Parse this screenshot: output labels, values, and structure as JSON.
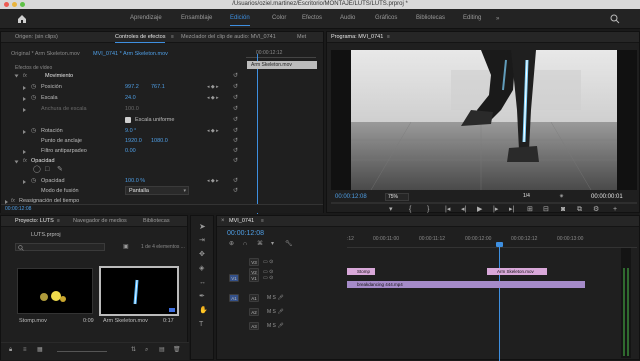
{
  "window": {
    "title": "/Usuarios/oziel.martinez/Escritorio/MONTAJE/LUTS/LUTS.prproj *"
  },
  "workspaces": [
    "Aprendizaje",
    "Ensamblaje",
    "Edición",
    "Color",
    "Efectos",
    "Audio",
    "Gráficos",
    "Bibliotecas",
    "Editing"
  ],
  "active_workspace": "Edición",
  "effect_controls": {
    "tabs": [
      "Origen: (sin clips)",
      "Controles de efectos",
      "Mezclador del clip de audio: MVI_0741",
      "Met"
    ],
    "source_label": "Original * Arm Skeleton.mov",
    "seq_label": "MVI_0741 * Arm Skeleton.mov",
    "ruler_time": "00:00:12:12",
    "clip_name": "Arm Skeleton.mov",
    "video_effects_header": "Efectos de vídeo",
    "motion": "Movimiento",
    "rows": [
      {
        "name": "Posición",
        "v1": "997.2",
        "v2": "767.1"
      },
      {
        "name": "Escala",
        "v1": "24.0",
        "v2": ""
      },
      {
        "name": "Anchura de escala",
        "v1": "100.0",
        "v2": ""
      },
      {
        "name": "",
        "v1": "Escala uniforme",
        "v2": ""
      },
      {
        "name": "Rotación",
        "v1": "9.0 °",
        "v2": ""
      },
      {
        "name": "Punto de anclaje",
        "v1": "1920.0",
        "v2": "1080.0"
      },
      {
        "name": "Filtro antiparpadeo",
        "v1": "0.00",
        "v2": ""
      }
    ],
    "opacity": "Opacidad",
    "opacity_value": "100.0 %",
    "opacity_label": "Opacidad",
    "blend_label": "Modo de fusión",
    "blend_value": "Pantalla",
    "time_remap": "Reasignación del tiempo",
    "timecode": "00:00:12:08"
  },
  "program_monitor": {
    "title": "Programa: MVI_0741",
    "timecode": "00:00:12:08",
    "zoom": "75%",
    "resolution": "1/4",
    "duration": "00:00:00:01"
  },
  "project": {
    "tabs": [
      "Proyecto: LUTS",
      "Navegador de medios",
      "Bibliotecas"
    ],
    "file": "LUTS.prproj",
    "items_count": "1 de 4 elementos ...",
    "clips": [
      {
        "name": "Stomp.mov",
        "dur": "0:09"
      },
      {
        "name": "Arm Skeleton.mov",
        "dur": "0:17"
      }
    ]
  },
  "timeline": {
    "tab": "MVI_0741",
    "timecode": "00:00:12:08",
    "ruler": [
      ":12",
      "00:00:11:00",
      "00:00:11:12",
      "00:00:12:00",
      "00:00:12:12",
      "00:00:13:00"
    ],
    "video_tracks": [
      "V3",
      "V2",
      "V1"
    ],
    "audio_tracks": [
      "A1",
      "A2",
      "A3"
    ],
    "clips": {
      "stomp": "Stomp",
      "arm": "Arm Skeleton.mov",
      "main": "breakdancing 444.mp4"
    }
  },
  "colors": {
    "accent": "#3e8fe0",
    "clip_pink": "#d9a8d9",
    "clip_purple": "#a58bc9"
  }
}
